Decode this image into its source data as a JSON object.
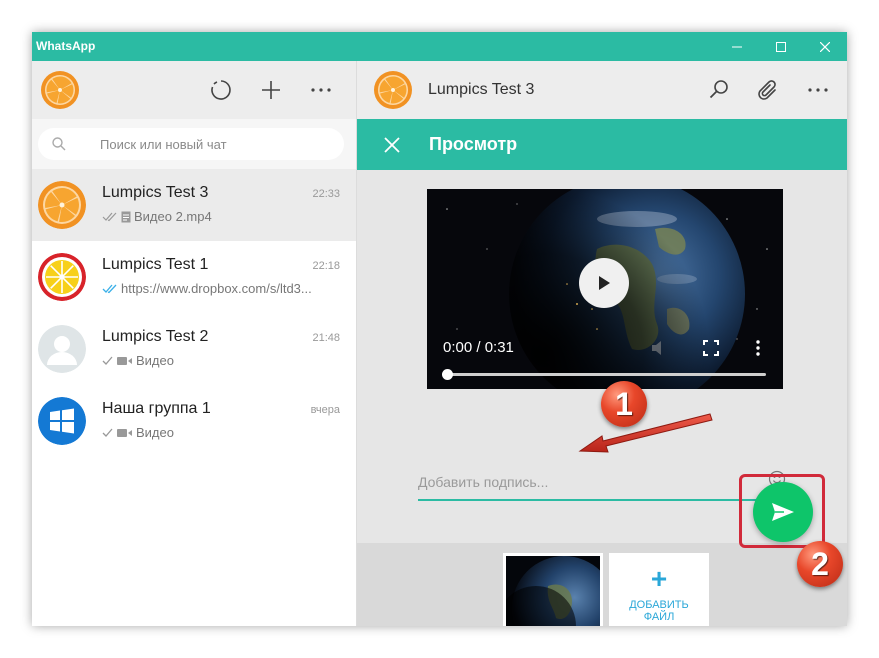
{
  "window": {
    "title": "WhatsApp",
    "controls": [
      "minimize-icon",
      "maximize-icon",
      "close-icon"
    ]
  },
  "sidebar": {
    "header_icons": [
      "status-icon",
      "new-chat-icon",
      "more-icon"
    ],
    "search": {
      "placeholder": "Поиск или новый чат",
      "value": ""
    },
    "chats": [
      {
        "name": "Lumpics Test 3",
        "time": "22:33",
        "preview": "Видео 2.mp4",
        "status": "delivered",
        "preview_icon": "document-icon",
        "active": true
      },
      {
        "name": "Lumpics Test 1",
        "time": "22:18",
        "preview": "https://www.dropbox.com/s/ltd3...",
        "status": "read",
        "preview_icon": ""
      },
      {
        "name": "Lumpics Test 2",
        "time": "21:48",
        "preview": "Видео",
        "status": "sent",
        "preview_icon": "video-icon"
      },
      {
        "name": "Наша группа 1",
        "time": "вчера",
        "preview": "Видео",
        "status": "sent",
        "preview_icon": "video-icon"
      }
    ]
  },
  "conversation": {
    "contact_name": "Lumpics Test 3",
    "header_icons": [
      "search-icon",
      "attach-icon",
      "more-icon"
    ],
    "preview_title": "Просмотр",
    "video": {
      "time": "0:00 / 0:31",
      "progress": 0.0
    },
    "caption": {
      "placeholder": "Добавить подпись...",
      "value": ""
    },
    "add_file_label_line1": "ДОБАВИТЬ",
    "add_file_label_line2": "ФАЙЛ"
  },
  "annotations": {
    "step1": "1",
    "step2": "2"
  },
  "colors": {
    "accent": "#2bbba3",
    "send": "#0ec56a",
    "badge": "#e8472a",
    "frame": "#d12a3a",
    "link": "#2aa7d8"
  }
}
